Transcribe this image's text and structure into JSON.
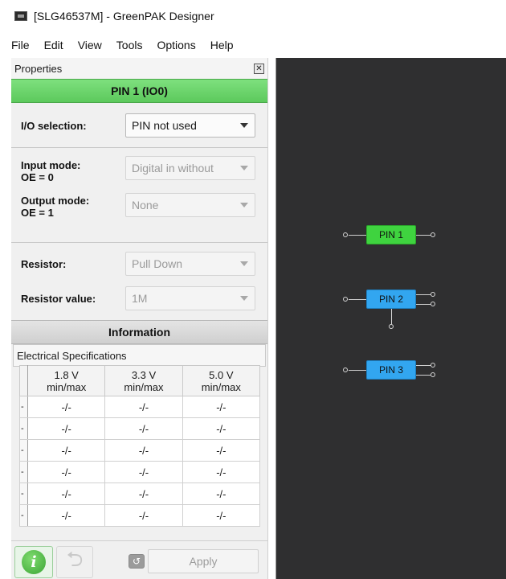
{
  "window": {
    "title": "[SLG46537M] - GreenPAK Designer"
  },
  "menu": [
    "File",
    "Edit",
    "View",
    "Tools",
    "Options",
    "Help"
  ],
  "properties": {
    "dock_title": "Properties",
    "close_glyph": "✕",
    "pin_title": "PIN 1 (IO0)",
    "io_selection": {
      "label": "I/O selection:",
      "value": "PIN not used"
    },
    "input_mode": {
      "label_line1": "Input mode:",
      "label_line2": "OE = 0",
      "value": "Digital in without"
    },
    "output_mode": {
      "label_line1": "Output mode:",
      "label_line2": "OE = 1",
      "value": "None"
    },
    "resistor": {
      "label": "Resistor:",
      "value": "Pull Down"
    },
    "resistor_value": {
      "label": "Resistor value:",
      "value": "1M"
    },
    "information_title": "Information",
    "electrical_label": "Electrical Specifications",
    "table": {
      "headers": [
        {
          "line1": "1.8 V",
          "line2": "min/max"
        },
        {
          "line1": "3.3 V",
          "line2": "min/max"
        },
        {
          "line1": "5.0 V",
          "line2": "min/max"
        }
      ],
      "rows": [
        {
          "rh": "-",
          "cells": [
            "-/-",
            "-/-",
            "-/-"
          ]
        },
        {
          "rh": "-",
          "cells": [
            "-/-",
            "-/-",
            "-/-"
          ]
        },
        {
          "rh": "-",
          "cells": [
            "-/-",
            "-/-",
            "-/-"
          ]
        },
        {
          "rh": "-",
          "cells": [
            "-/-",
            "-/-",
            "-/-"
          ]
        },
        {
          "rh": "-",
          "cells": [
            "-/-",
            "-/-",
            "-/-"
          ]
        },
        {
          "rh": "-",
          "cells": [
            "-/-",
            "-/-",
            "-/-"
          ]
        }
      ]
    },
    "buttons": {
      "info_glyph": "i",
      "undo_glyph": "⮌",
      "revert_glyph": "↺",
      "apply": "Apply"
    }
  },
  "canvas": {
    "blocks": [
      {
        "label": "PIN 1",
        "color": "#3fd33f"
      },
      {
        "label": "PIN 2",
        "color": "#32a6f0"
      },
      {
        "label": "PIN 3",
        "color": "#32a6f0"
      }
    ]
  }
}
